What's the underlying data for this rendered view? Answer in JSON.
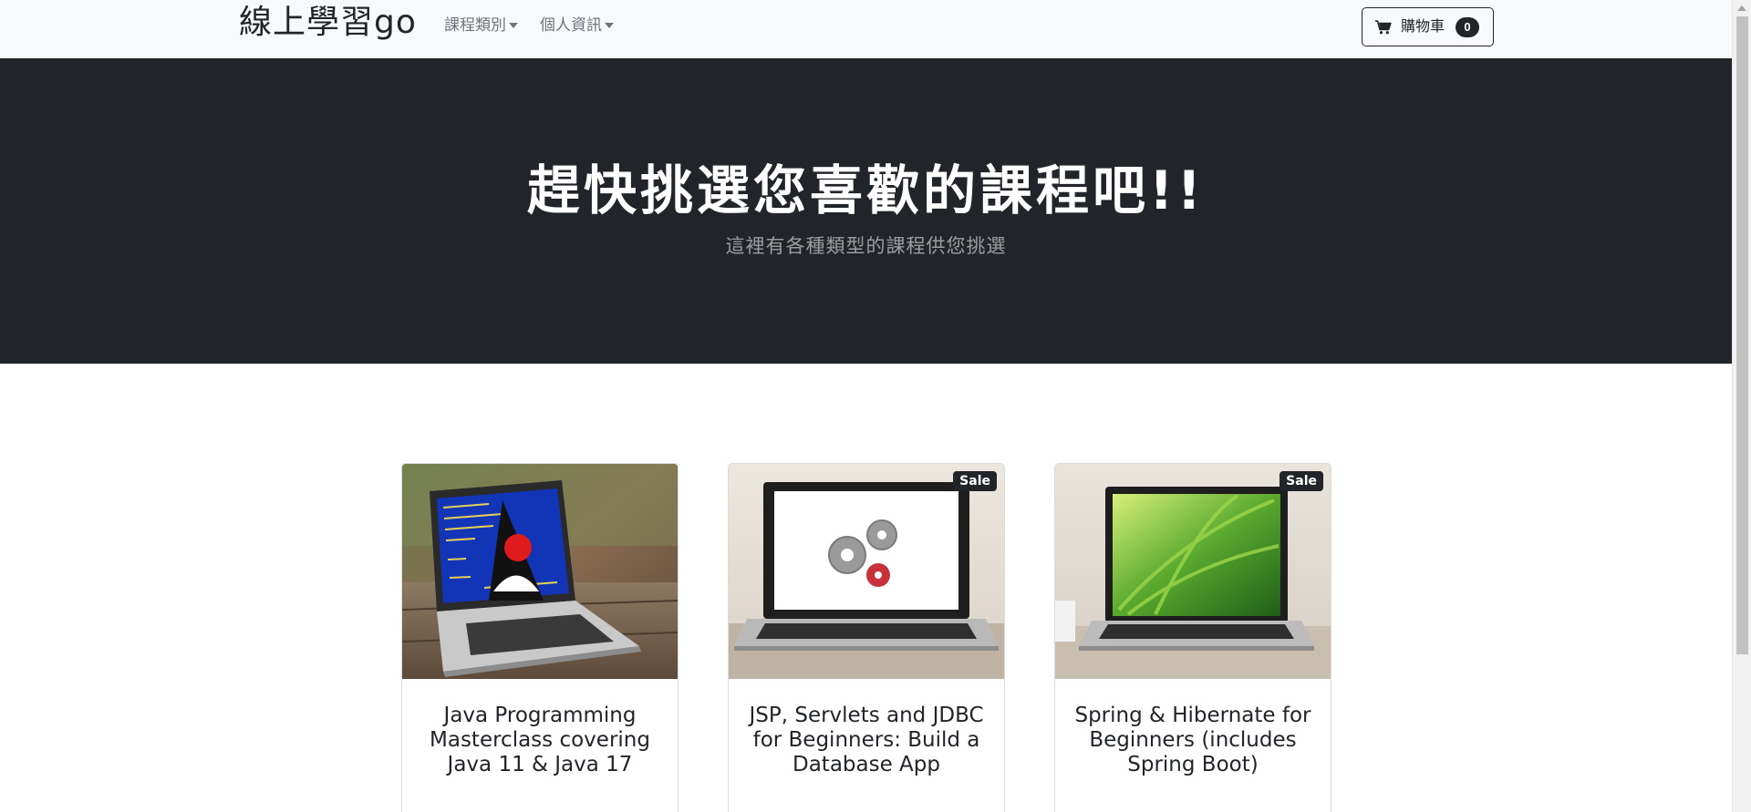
{
  "navbar": {
    "brand": "線上學習go",
    "menu": [
      {
        "label": "課程類別"
      },
      {
        "label": "個人資訊"
      }
    ],
    "cart": {
      "label": "購物車",
      "count": "0",
      "icon": "cart-icon"
    }
  },
  "hero": {
    "title": "趕快挑選您喜歡的課程吧!!",
    "subtitle": "這裡有各種類型的課程供您挑選"
  },
  "courses": [
    {
      "title": "Java Programming Masterclass covering Java 11 & Java 17",
      "badge": "",
      "image": "laptop-java-duke"
    },
    {
      "title": "JSP, Servlets and JDBC for Beginners: Build a Database App",
      "badge": "Sale",
      "image": "laptop-gears"
    },
    {
      "title": "Spring & Hibernate for Beginners (includes Spring Boot)",
      "badge": "Sale",
      "image": "laptop-grass"
    }
  ],
  "colors": {
    "navbar_bg": "#f8f9fa",
    "hero_bg": "#212529",
    "badge_bg": "#212529",
    "muted_text": "#6c757d"
  }
}
